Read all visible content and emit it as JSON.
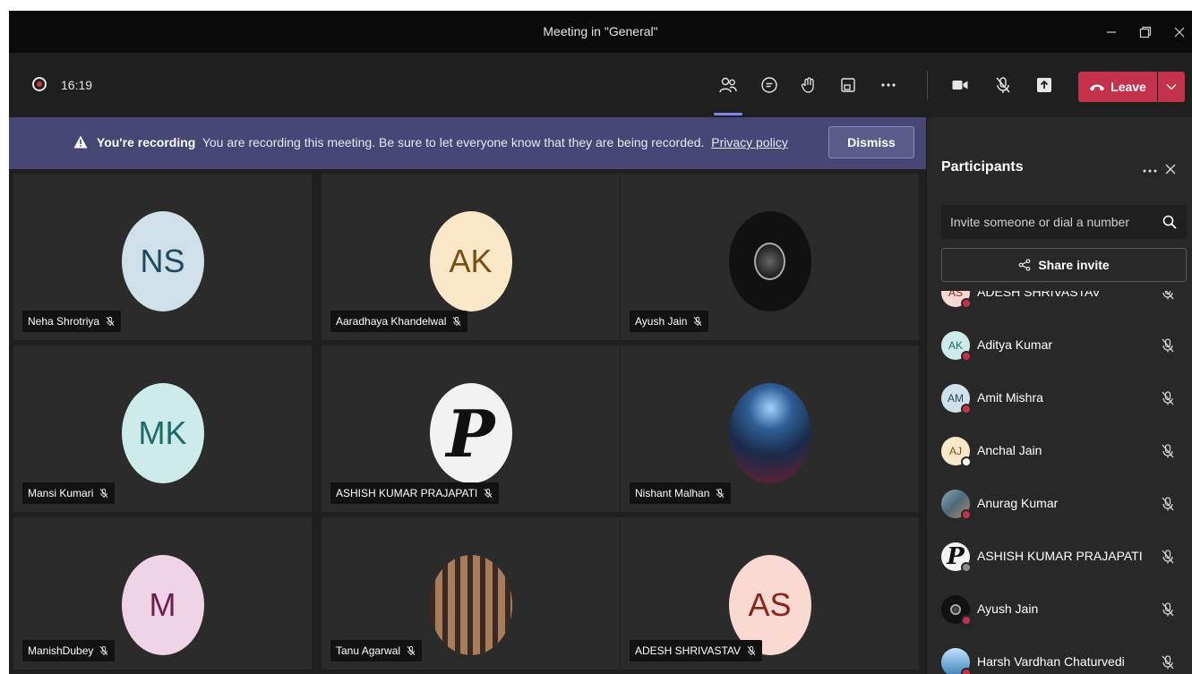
{
  "window": {
    "title": "Meeting in \"General\""
  },
  "toolbar": {
    "timer": "16:19",
    "leave_label": "Leave"
  },
  "banner": {
    "heading": "You're recording",
    "message": "You are recording this meeting. Be sure to let everyone know that they are being recorded.",
    "link": "Privacy policy",
    "dismiss_label": "Dismiss"
  },
  "tiles": [
    {
      "name": "Neha Shrotriya",
      "initials": "NS",
      "bg": "#cfe0e8",
      "fg": "#1d4a60"
    },
    {
      "name": "Aaradhaya Khandelwal",
      "initials": "AK",
      "bg": "#fbe8c8",
      "fg": "#7a4f10"
    },
    {
      "name": "Ayush Jain",
      "initials": "",
      "bg": "#111111",
      "fg": "#cccccc",
      "image": "dark-logo-photo"
    },
    {
      "name": "Mansi Kumari",
      "initials": "MK",
      "bg": "#cdebe8",
      "fg": "#1c6b6a"
    },
    {
      "name": "ASHISH KUMAR PRAJAPATI",
      "initials": "",
      "bg": "#f2f2f2",
      "fg": "#111111",
      "image": "letter-p-logo"
    },
    {
      "name": "Nishant Malhan",
      "initials": "",
      "bg": "#355d8c",
      "fg": "#ffffff",
      "image": "night-portrait-photo"
    },
    {
      "name": "ManishDubey",
      "initials": "M",
      "bg": "#f1d3e6",
      "fg": "#6a1f4f"
    },
    {
      "name": "Tanu Agarwal",
      "initials": "",
      "bg": "#8a6048",
      "fg": "#ffffff",
      "image": "window-portrait-photo"
    },
    {
      "name": "ADESH SHRIVASTAV",
      "initials": "AS",
      "bg": "#fbd9d3",
      "fg": "#8a2417"
    }
  ],
  "panel": {
    "title": "Participants",
    "invite_placeholder": "Invite someone or dial a number",
    "share_invite_label": "Share invite"
  },
  "participants": [
    {
      "name": "ADESH SHRIVASTAV",
      "initials": "AS",
      "bg": "#fbd9d3",
      "fg": "#8a2417",
      "status": "#c4314b"
    },
    {
      "name": "Aditya Kumar",
      "initials": "AK",
      "bg": "#cdebe8",
      "fg": "#1c6b6a",
      "status": "#c4314b"
    },
    {
      "name": "Amit Mishra",
      "initials": "AM",
      "bg": "#cfe0e8",
      "fg": "#1d4a60",
      "status": "#c4314b"
    },
    {
      "name": "Anchal Jain",
      "initials": "AJ",
      "bg": "#fbe8c8",
      "fg": "#7a4f10",
      "status": "#ffffff"
    },
    {
      "name": "Anurag Kumar",
      "initials": "",
      "bg": "#5b7a8a",
      "fg": "#ffffff",
      "status": "#c4314b",
      "image": "group-photo"
    },
    {
      "name": "ASHISH KUMAR PRAJAPATI",
      "initials": "",
      "bg": "#f2f2f2",
      "fg": "#111111",
      "status": "#8a8a8a",
      "image": "letter-p-logo"
    },
    {
      "name": "Ayush Jain",
      "initials": "",
      "bg": "#111111",
      "fg": "#cccccc",
      "status": "#c4314b",
      "image": "dark-logo-photo"
    },
    {
      "name": "Harsh Vardhan Chaturvedi",
      "initials": "",
      "bg": "#3d7fb5",
      "fg": "#ffffff",
      "status": "#c4314b",
      "image": "sky-photo"
    }
  ],
  "icons": {
    "people": "people-icon",
    "chat": "chat-icon",
    "raise_hand": "raise-hand-icon",
    "rooms": "rooms-icon",
    "more": "more-icon",
    "camera": "camera-icon",
    "mic_off": "mic-off-icon",
    "share": "share-screen-icon",
    "phone": "phone-icon",
    "warning": "warning-icon",
    "search": "search-icon",
    "close": "close-icon"
  }
}
